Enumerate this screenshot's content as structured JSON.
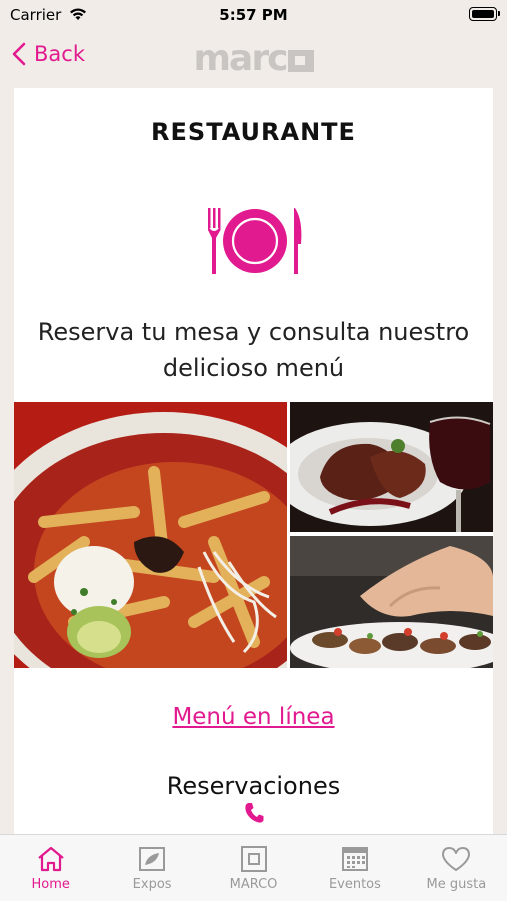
{
  "status_bar": {
    "carrier": "Carrier",
    "time": "5:57 PM"
  },
  "nav": {
    "back_label": "Back",
    "logo_text": "marc"
  },
  "content": {
    "title": "RESTAURANTE",
    "icon": "plate-fork-knife-icon",
    "subtitle_line1": "Reserva tu mesa y consulta nuestro",
    "subtitle_line2": "delicioso menú",
    "menu_link": "Menú en línea",
    "reservations_heading": "Reservaciones",
    "phone_icon": "phone-icon"
  },
  "tabs": [
    {
      "label": "Home",
      "icon": "home-icon",
      "active": true
    },
    {
      "label": "Expos",
      "icon": "expos-icon",
      "active": false
    },
    {
      "label": "MARCO",
      "icon": "marco-square-icon",
      "active": false
    },
    {
      "label": "Eventos",
      "icon": "calendar-icon",
      "active": false
    },
    {
      "label": "Me gusta",
      "icon": "heart-icon",
      "active": false
    }
  ],
  "colors": {
    "accent": "#e21a8f",
    "background": "#f1ece7",
    "tab_inactive": "#9a9a9a",
    "logo_gray": "#c9c5c2"
  }
}
